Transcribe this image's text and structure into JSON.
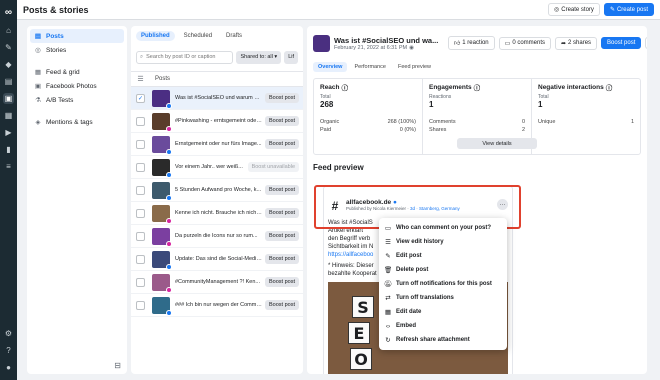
{
  "app": {
    "title": "Posts & stories",
    "create_story": "Create story",
    "create_post": "Create post"
  },
  "sidebar": {
    "items": [
      {
        "label": "Posts",
        "icon": "document-icon",
        "active": true
      },
      {
        "label": "Stories",
        "icon": "story-icon",
        "active": false
      },
      {
        "label": "Feed & grid",
        "icon": "grid-icon",
        "active": false
      },
      {
        "label": "Facebook Photos",
        "icon": "photo-icon",
        "active": false
      },
      {
        "label": "A/B Tests",
        "icon": "flask-icon",
        "active": false
      },
      {
        "label": "Mentions & tags",
        "icon": "tag-icon",
        "active": false
      }
    ]
  },
  "list": {
    "tabs": [
      "Published",
      "Scheduled",
      "Drafts"
    ],
    "search_placeholder": "Search by post ID or caption",
    "shared_filter": "Shared to: all",
    "extra_filter": "Lif",
    "column_header": "Posts",
    "rows": [
      {
        "text": "Was ist #SocialSEO und warum br...",
        "action": "Boost post",
        "color": "#4b2e83",
        "network": "facebook",
        "selected": true
      },
      {
        "text": "#Pinkwashing - erntsgemeint oder...",
        "action": "Boost post",
        "color": "#5a3d2b",
        "network": "instagram",
        "selected": false
      },
      {
        "text": "Ernstgemeint oder nur fürs Image...",
        "action": "Boost post",
        "color": "#6a4b9c",
        "network": "facebook",
        "selected": false
      },
      {
        "text": "Vor einem Jahr.. wer weiß...",
        "action": "Boost unavailable",
        "color": "#2a2a2a",
        "network": "facebook",
        "selected": false,
        "disabled": true
      },
      {
        "text": "5 Stunden Aufwand pro Woche, k...",
        "action": "Boost post",
        "color": "#3d5a6c",
        "network": "facebook",
        "selected": false
      },
      {
        "text": "Kenne ich nicht. Brauche ich nicht...",
        "action": "Boost post",
        "color": "#8a6b4a",
        "network": "instagram",
        "selected": false
      },
      {
        "text": "Da purzeln die Icons nur so rum...",
        "action": "Boost post",
        "color": "#7b3fa0",
        "network": "instagram",
        "selected": false
      },
      {
        "text": "Update: Das sind die Social-Media...",
        "action": "Boost post",
        "color": "#3b4a7a",
        "network": "facebook",
        "selected": false
      },
      {
        "text": "#CommunityManagement ?! Ken...",
        "action": "Boost post",
        "color": "#9b5a8a",
        "network": "instagram",
        "selected": false
      },
      {
        "text": "### Ich bin nur wegen der Commen...",
        "action": "Boost post",
        "color": "#2f6b8a",
        "network": "facebook",
        "selected": false
      }
    ]
  },
  "detail": {
    "title": "Was ist #SocialSEO und wa...",
    "date": "February 21, 2022 at 6:31 PM",
    "reaction_btn": "1 reaction",
    "comments_btn": "0 comments",
    "shares_btn": "2 shares",
    "boost_btn": "Boost post",
    "tabs": [
      "Overview",
      "Performance",
      "Feed preview"
    ],
    "metrics": {
      "reach": {
        "title": "Reach",
        "total_label": "Total",
        "total": "268",
        "organic_label": "Organic",
        "organic": "268 (100%)",
        "paid_label": "Paid",
        "paid": "0 (0%)"
      },
      "engagements": {
        "title": "Engagements",
        "reactions_label": "Reactions",
        "reactions": "1",
        "comments_label": "Comments",
        "comments": "0",
        "shares_label": "Shares",
        "shares": "2",
        "view_details": "View details"
      },
      "negative": {
        "title": "Negative interactions",
        "total_label": "Total",
        "total": "1",
        "unique_label": "Unique",
        "unique": "1"
      }
    },
    "feed_preview_title": "Feed preview",
    "preview": {
      "page_name": "allfacebook.de",
      "published_by": "Published by Nicola Kiermeier",
      "meta": "3d · Starnberg, Germany",
      "body1": "Was ist #SocialS",
      "body2": "Artikel erklärt",
      "body3": "den Begriff verb",
      "body4": "Sichtbarkeit im N",
      "link": "https://allfaceboo",
      "hint1": "* Hinweis: Dieser",
      "hint2": "bezahlte Kooperat",
      "tiles": [
        "S",
        "E",
        "O"
      ]
    },
    "menu": [
      {
        "label": "Who can comment on your post?",
        "icon": "comment-icon"
      },
      {
        "label": "View edit history",
        "icon": "history-icon"
      },
      {
        "label": "Edit post",
        "icon": "pencil-icon"
      },
      {
        "label": "Delete post",
        "icon": "trash-icon"
      },
      {
        "label": "Turn off notifications for this post",
        "icon": "bell-off-icon"
      },
      {
        "label": "Turn off translations",
        "icon": "translate-icon"
      },
      {
        "label": "Edit date",
        "icon": "calendar-icon"
      },
      {
        "label": "Embed",
        "icon": "code-icon"
      },
      {
        "label": "Refresh share attachment",
        "icon": "refresh-icon"
      }
    ]
  },
  "colors": {
    "accent": "#1877f2",
    "highlight": "#e0412e",
    "rail": "#1c2b33"
  }
}
